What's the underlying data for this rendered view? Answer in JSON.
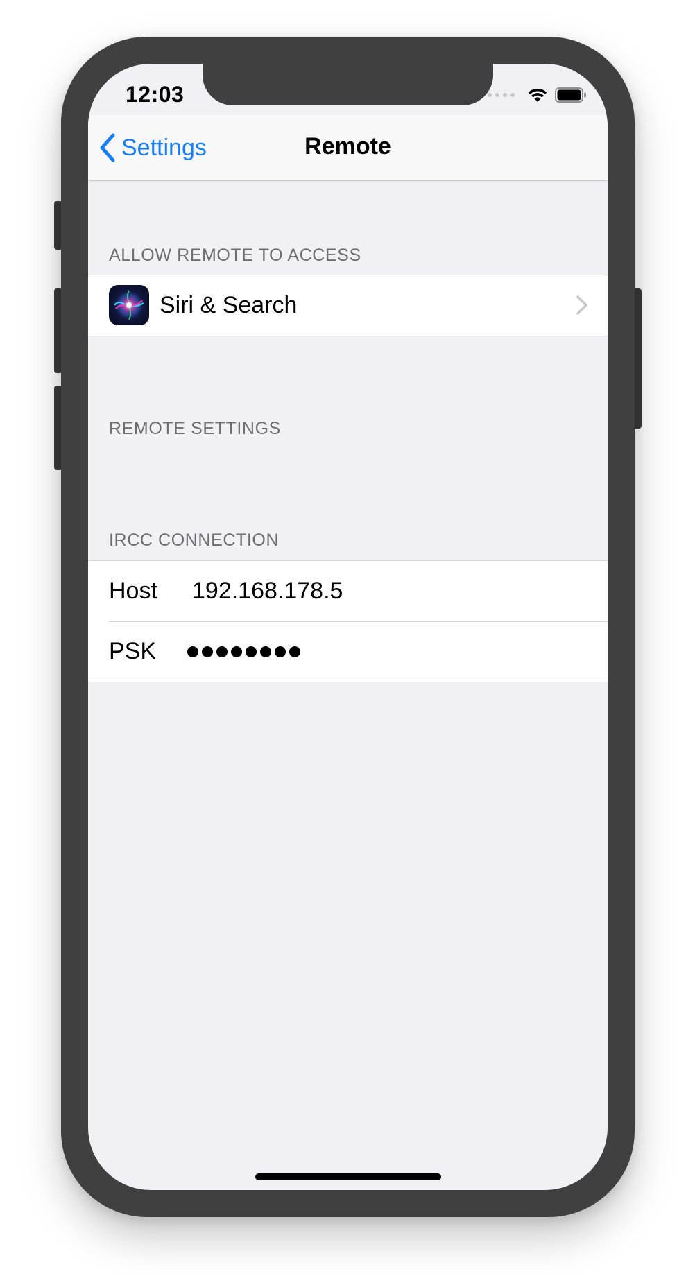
{
  "status_bar": {
    "time": "12:03"
  },
  "navbar": {
    "back_label": "Settings",
    "title": "Remote"
  },
  "sections": {
    "allow_access": {
      "header": "ALLOW REMOTE TO ACCESS",
      "items": [
        {
          "label": "Siri & Search",
          "icon": "siri-icon"
        }
      ]
    },
    "remote_settings": {
      "header": "REMOTE SETTINGS"
    },
    "ircc_connection": {
      "header": "IRCC CONNECTION",
      "host": {
        "label": "Host",
        "value": "192.168.178.5"
      },
      "psk": {
        "label": "PSK",
        "value": "••••••••"
      }
    }
  },
  "colors": {
    "accent": "#147efb",
    "background": "#f0f0f5",
    "frame": "#404040",
    "section_header": "#6d6d72"
  }
}
